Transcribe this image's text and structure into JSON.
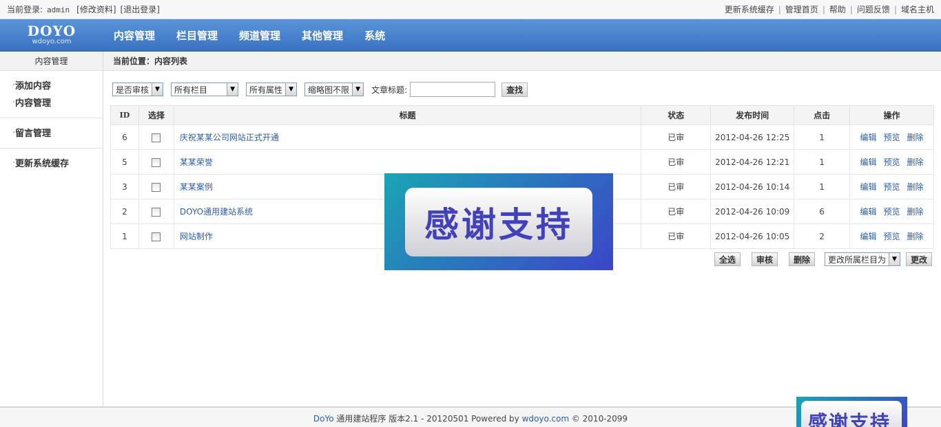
{
  "topbar": {
    "login_label": "当前登录:",
    "username": "admin",
    "edit_profile": "[修改资料]",
    "logout": "[退出登录]",
    "links": [
      "更新系统缓存",
      "管理首页",
      "帮助",
      "问题反馈",
      "域名主机"
    ],
    "separator": "|"
  },
  "header": {
    "brand": "DOYO",
    "brand_sub": "wdoyo.com",
    "nav": [
      "内容管理",
      "栏目管理",
      "频道管理",
      "其他管理",
      "系统"
    ]
  },
  "sidebar": {
    "title": "内容管理",
    "group1": [
      "添加内容",
      "内容管理"
    ],
    "group2": [
      "留言管理"
    ],
    "group3": [
      "更新系统缓存"
    ]
  },
  "breadcrumb": "当前位置：内容列表",
  "filters": {
    "review": "是否审核",
    "column": "所有栏目",
    "attribute": "所有属性",
    "thumb": "缩略图不限",
    "title_label": "文章标题:",
    "title_value": "",
    "search_button": "查找"
  },
  "table": {
    "headers": [
      "ID",
      "选择",
      "标题",
      "状态",
      "发布时间",
      "点击",
      "操作"
    ],
    "rows": [
      {
        "id": "6",
        "title": "庆祝某某公司网站正式开通",
        "status": "已审",
        "time": "2012-04-26 12:25",
        "clicks": "1"
      },
      {
        "id": "5",
        "title": "某某荣誉",
        "status": "已审",
        "time": "2012-04-26 12:21",
        "clicks": "1"
      },
      {
        "id": "3",
        "title": "某某案例",
        "status": "已审",
        "time": "2012-04-26 10:14",
        "clicks": "1"
      },
      {
        "id": "2",
        "title": "DOYO通用建站系统",
        "status": "已审",
        "time": "2012-04-26 10:09",
        "clicks": "6"
      },
      {
        "id": "1",
        "title": "网站制作",
        "status": "已审",
        "time": "2012-04-26 10:05",
        "clicks": "2"
      }
    ],
    "ops": {
      "edit": "编辑",
      "preview": "预览",
      "delete": "删除"
    }
  },
  "actions": {
    "select_all": "全选",
    "review": "审核",
    "delete": "删除",
    "change_column": "更改所属栏目为",
    "change": "更改"
  },
  "footer": {
    "brand": "DoYo",
    "text1": "通用建站程序 版本2.1 - 20120501 Powered by",
    "site": "wdoyo.com",
    "text2": "© 2010-2099"
  },
  "overlay": {
    "text": "感谢支持"
  }
}
